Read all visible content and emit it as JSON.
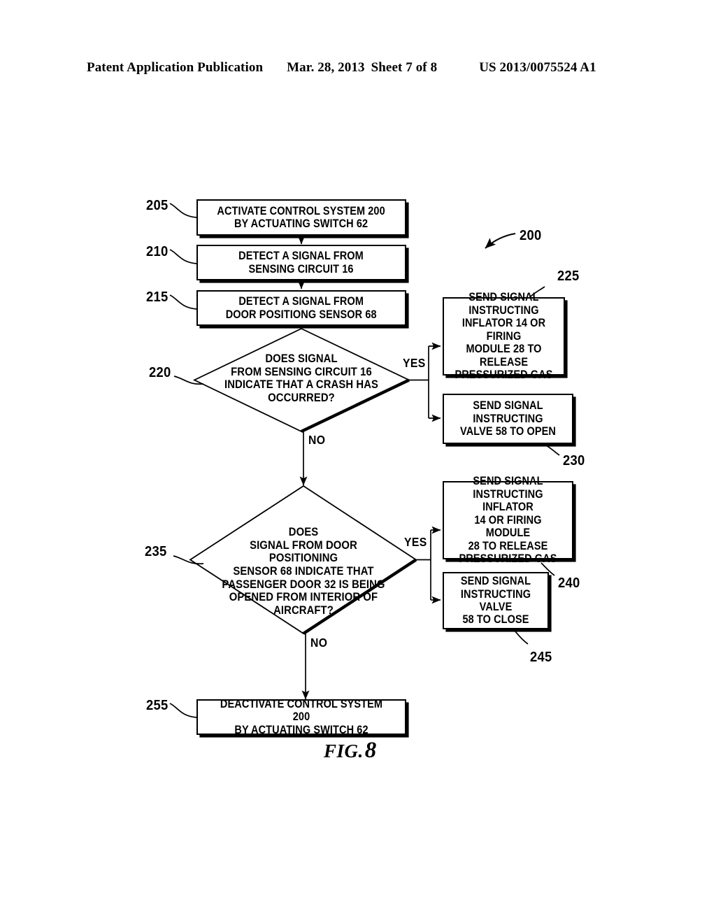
{
  "header": {
    "publication": "Patent Application Publication",
    "date": "Mar. 28, 2013",
    "sheet": "Sheet 7 of 8",
    "patent_number": "US 2013/0075524 A1"
  },
  "figure": {
    "caption_prefix": "FIG.",
    "caption_number": "8",
    "system_ref": "200"
  },
  "flowchart": {
    "steps": [
      {
        "ref": "205",
        "type": "process",
        "text": "ACTIVATE CONTROL SYSTEM 200\nBY ACTUATING SWITCH 62"
      },
      {
        "ref": "210",
        "type": "process",
        "text": "DETECT A SIGNAL FROM\nSENSING CIRCUIT 16"
      },
      {
        "ref": "215",
        "type": "process",
        "text": "DETECT A SIGNAL FROM\nDOOR POSITIONG SENSOR 68"
      },
      {
        "ref": "220",
        "type": "decision",
        "text": "DOES SIGNAL\nFROM SENSING CIRCUIT 16\nINDICATE THAT A CRASH HAS\nOCCURRED?"
      },
      {
        "ref": "225",
        "type": "process",
        "text": "SEND SIGNAL\nINSTRUCTING\nINFLATOR 14 OR FIRING\nMODULE 28 TO RELEASE\nPRESSURIZED GAS"
      },
      {
        "ref": "230",
        "type": "process",
        "text": "SEND SIGNAL INSTRUCTING\nVALVE 58 TO OPEN"
      },
      {
        "ref": "235",
        "type": "decision",
        "text": "DOES\nSIGNAL FROM DOOR POSITIONING\nSENSOR 68 INDICATE THAT\nPASSENGER DOOR 32 IS BEING\nOPENED FROM INTERIOR OF\nAIRCRAFT?"
      },
      {
        "ref": "240",
        "type": "process",
        "text": "SEND SIGNAL\nINSTRUCTING INFLATOR\n14 OR FIRING MODULE\n28 TO RELEASE\nPRESSURIZED GAS"
      },
      {
        "ref": "245",
        "type": "process",
        "text": "SEND SIGNAL\nINSTRUCTING VALVE\n58 TO CLOSE"
      },
      {
        "ref": "255",
        "type": "process",
        "text": "DEACTIVATE CONTROL SYSTEM 200\nBY ACTUATING SWITCH 62"
      }
    ],
    "branch_labels": {
      "yes_1": "YES",
      "no_1": "NO",
      "yes_2": "YES",
      "no_2": "NO"
    }
  }
}
